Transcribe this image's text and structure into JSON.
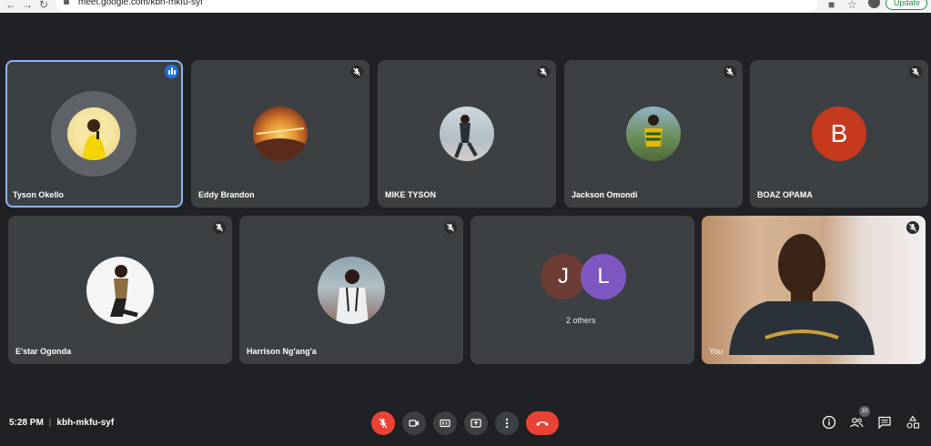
{
  "browser": {
    "url": "meet.google.com/kbh-mkfu-syf",
    "update_label": "Update"
  },
  "participants": [
    {
      "name": "Tyson Okello",
      "speaking": true
    },
    {
      "name": "Eddy Brandon",
      "muted": true
    },
    {
      "name": "MIKE TYSON",
      "muted": true
    },
    {
      "name": "Jackson Omondi",
      "muted": true
    },
    {
      "name": "BOAZ OPAMA",
      "muted": true,
      "initial": "B",
      "color": "#c5391f"
    },
    {
      "name": "E'star Ogonda",
      "muted": true
    },
    {
      "name": "Harrison Ng'ang'a",
      "muted": true
    }
  ],
  "others": {
    "label": "2 others",
    "initials": [
      {
        "letter": "J",
        "color": "#6d3c34"
      },
      {
        "letter": "L",
        "color": "#7e57c2"
      }
    ]
  },
  "self": {
    "name": "You"
  },
  "footer": {
    "time": "5:28 PM",
    "meeting_code": "kbh-mkfu-syf",
    "people_count": "10"
  },
  "colors": {
    "background": "#202124",
    "tile": "#3c4043",
    "accent": "#8ab4f8",
    "danger": "#ea4335"
  },
  "icons": [
    "mic-off-icon",
    "camera-icon",
    "captions-icon",
    "present-icon",
    "more-icon",
    "end-call-icon",
    "info-icon",
    "people-icon",
    "chat-icon",
    "activities-icon"
  ]
}
